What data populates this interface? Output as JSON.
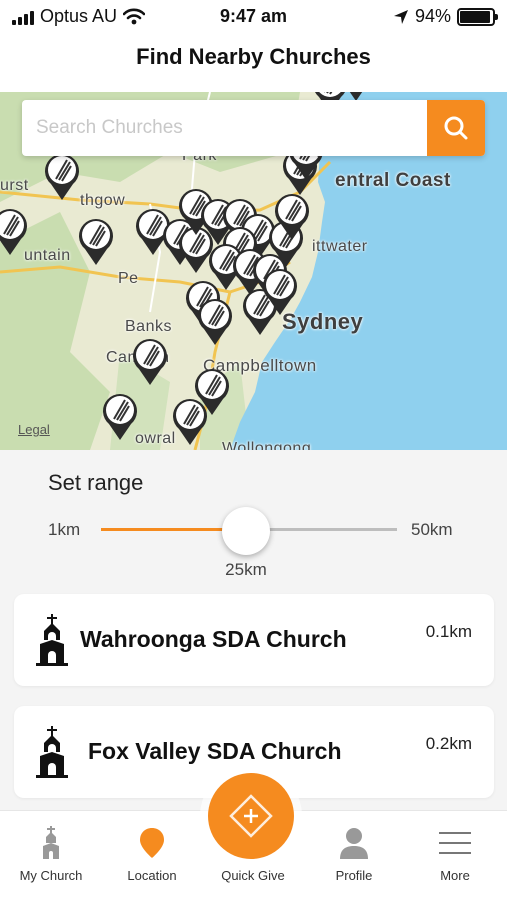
{
  "status_bar": {
    "carrier": "Optus AU",
    "time": "9:47 am",
    "battery_text": "94%",
    "battery_level": 0.94
  },
  "header": {
    "title": "Find Nearby Churches"
  },
  "search": {
    "placeholder": "Search Churches",
    "value": ""
  },
  "map": {
    "labels": {
      "park": "Park",
      "hurst": "urst",
      "lithgow": "thgow",
      "mountains": "untain",
      "penrith": "Pe",
      "central_coast": "entral Coast",
      "pittwater": "ittwater",
      "sydney": "Sydney",
      "banks": "Banks",
      "camden": "Camden",
      "campbelltown": "Campbelltown",
      "bowral": "owral",
      "wollongong": "Wollongong"
    },
    "legal": "Legal"
  },
  "range": {
    "title": "Set range",
    "min_label": "1km",
    "max_label": "50km",
    "value_label": "25km",
    "min": 1,
    "max": 50,
    "value": 25
  },
  "churches": [
    {
      "name": "Wahroonga SDA Church",
      "distance": "0.1km"
    },
    {
      "name": "Fox Valley SDA Church",
      "distance": "0.2km"
    }
  ],
  "tabs": {
    "my_church": "My Church",
    "location": "Location",
    "quick_give": "Quick Give",
    "profile": "Profile",
    "more": "More"
  },
  "colors": {
    "accent": "#f58b1f",
    "ocean": "#8fd0ee",
    "land": "#e9ead2",
    "forest": "#c8dca8"
  }
}
